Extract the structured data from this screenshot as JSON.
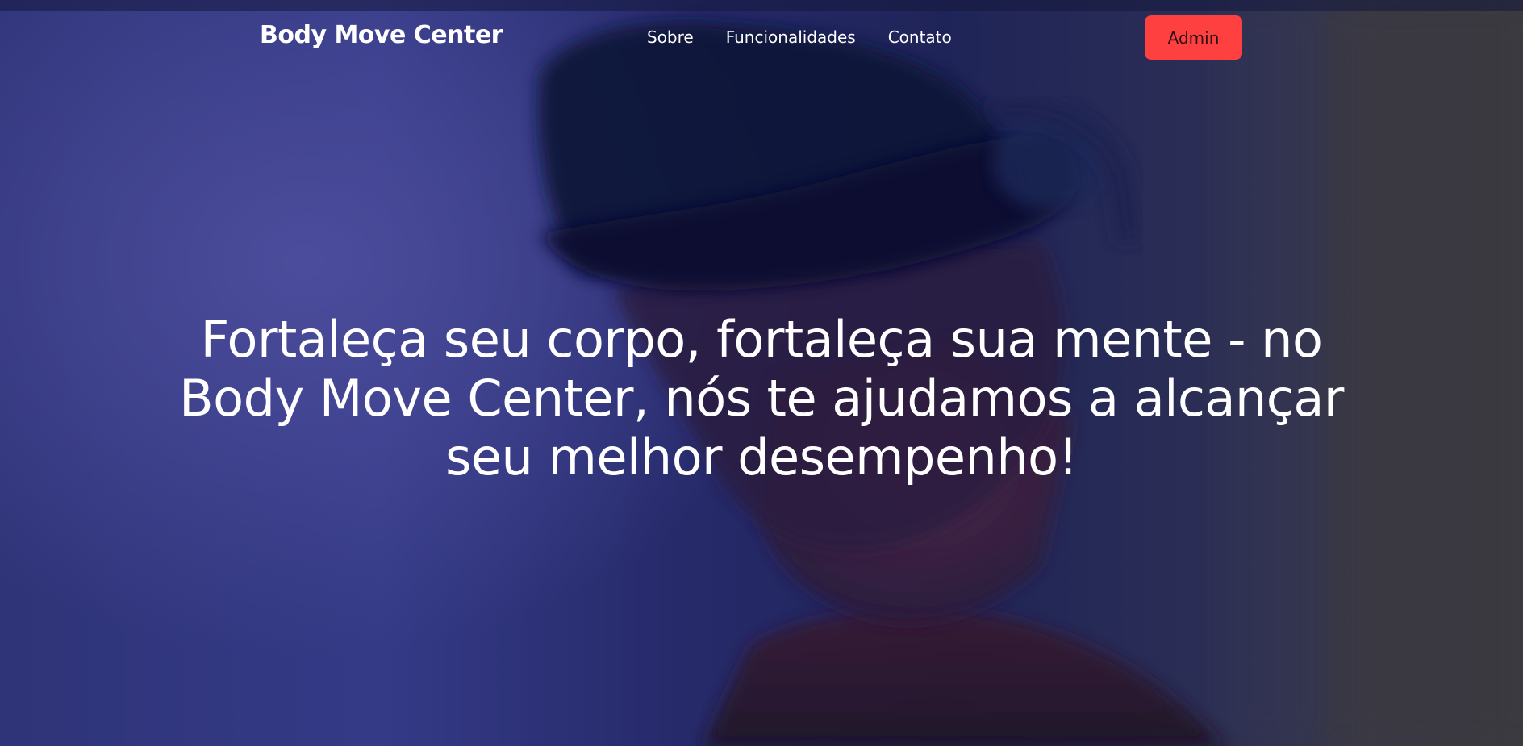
{
  "brand": {
    "name": "Body Move Center"
  },
  "nav": {
    "links": [
      {
        "label": "Sobre"
      },
      {
        "label": "Funcionalidades"
      },
      {
        "label": "Contato"
      }
    ],
    "admin_label": "Admin"
  },
  "hero": {
    "headline": "Fortaleça seu corpo, fortaleça sua mente - no Body Move Center, nós te ajudamos a alcançar seu melhor desempenho!",
    "background_image": "person-wearing-vr-headset"
  },
  "colors": {
    "accent": "#ff4040",
    "text": "#ffffff",
    "hero_tint": "#2f3478"
  }
}
